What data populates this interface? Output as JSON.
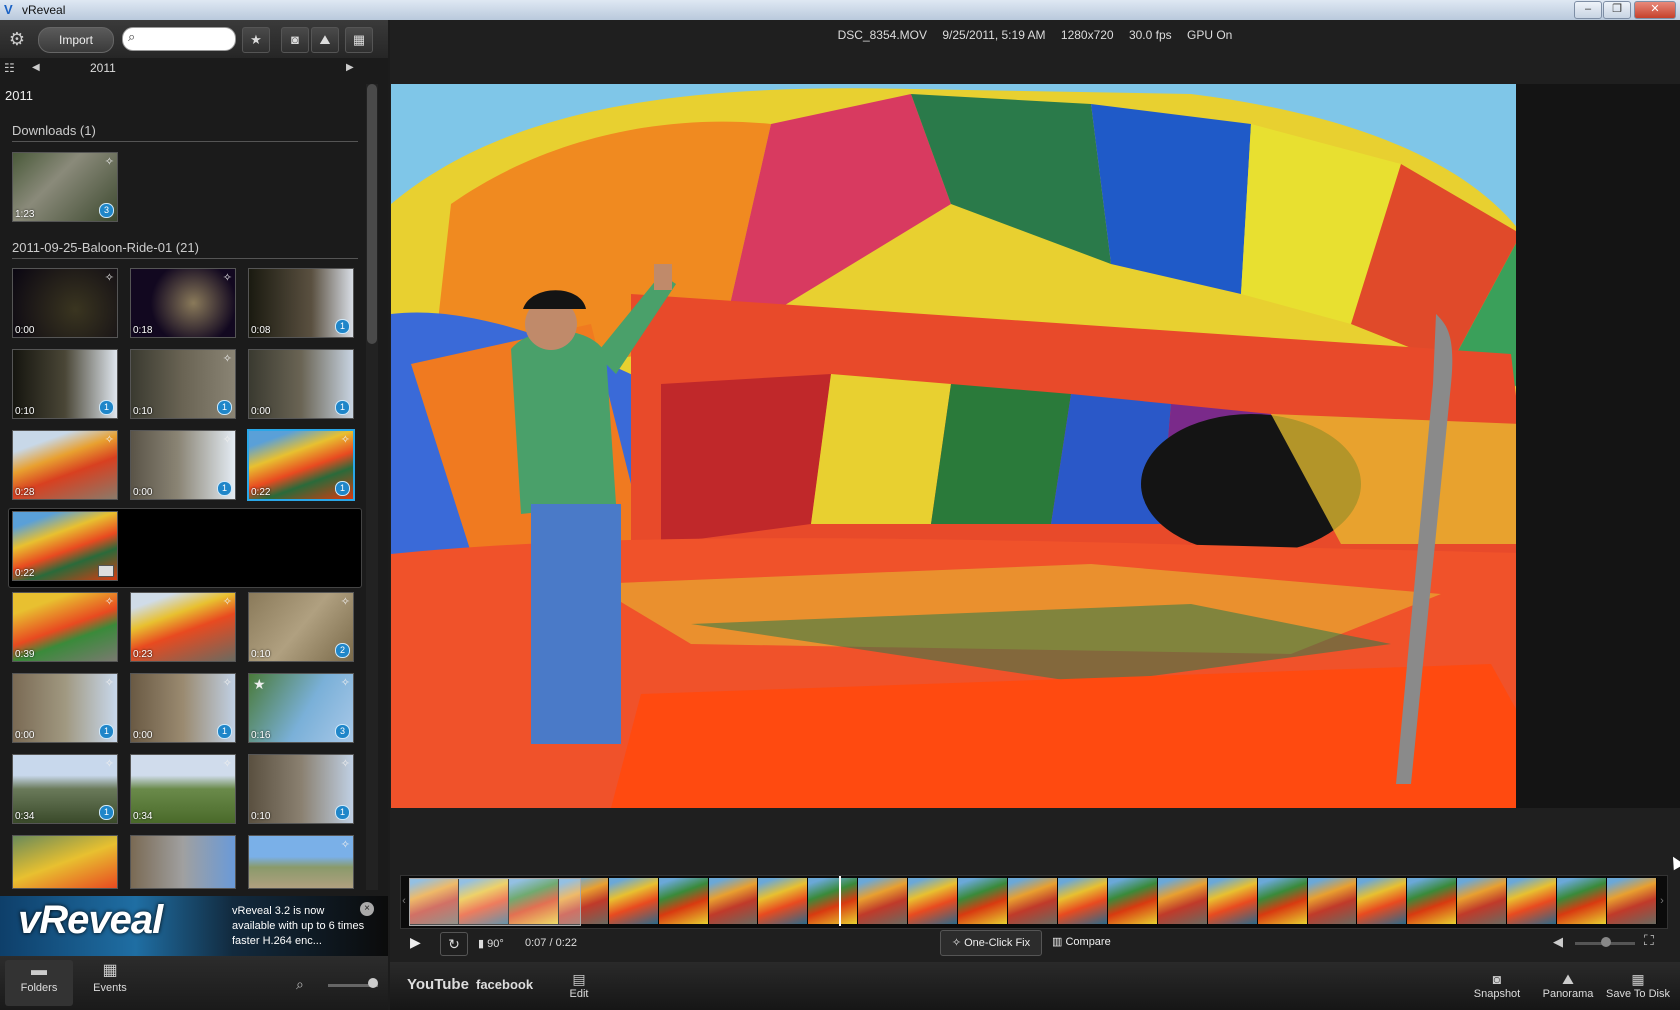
{
  "window": {
    "title": "vReveal",
    "logo": "V"
  },
  "toolbar": {
    "import_label": "Import",
    "search_placeholder": "",
    "gear_icon": "⚙",
    "star_icon": "★",
    "camera_icon": "📷",
    "panorama_icon": "⛰",
    "film_icon": "▦"
  },
  "nav": {
    "year": "2011",
    "prev": "◀",
    "next": "▶",
    "view_icon": "☷"
  },
  "library": {
    "year_heading": "2011",
    "groups": [
      {
        "title": "Downloads (1)"
      },
      {
        "title": "2011-09-25-Baloon-Ride-01 (21)"
      }
    ],
    "downloads": [
      {
        "duration": "1:23",
        "badge": "3"
      }
    ],
    "balloon_rows": [
      [
        {
          "duration": "0:00",
          "badge": ""
        },
        {
          "duration": "0:18",
          "badge": ""
        },
        {
          "duration": "0:08",
          "badge": "1"
        }
      ],
      [
        {
          "duration": "0:10",
          "badge": "1"
        },
        {
          "duration": "0:10",
          "badge": "1"
        },
        {
          "duration": "0:00",
          "badge": "1"
        }
      ],
      [
        {
          "duration": "0:28",
          "badge": ""
        },
        {
          "duration": "0:00",
          "badge": "1"
        },
        {
          "duration": "0:22",
          "badge": "1"
        }
      ],
      [
        {
          "duration": "0:22",
          "badge": ""
        }
      ],
      [
        {
          "duration": "0:39",
          "badge": ""
        },
        {
          "duration": "0:23",
          "badge": ""
        },
        {
          "duration": "0:10",
          "badge": "2"
        }
      ],
      [
        {
          "duration": "0:00",
          "badge": "1"
        },
        {
          "duration": "0:00",
          "badge": "1"
        },
        {
          "duration": "0:16",
          "badge": "3"
        }
      ],
      [
        {
          "duration": "0:34",
          "badge": "1"
        },
        {
          "duration": "0:34",
          "badge": ""
        },
        {
          "duration": "0:10",
          "badge": "1"
        }
      ]
    ]
  },
  "ad": {
    "logo": "vReveal",
    "text": "vReveal 3.2 is now available with up to 6 times  faster H.264 enc...",
    "close": "×"
  },
  "bottom_left": {
    "folders_label": "Folders",
    "events_label": "Events",
    "folders_icon": "▬",
    "events_icon": "▦",
    "zoom_icon": "🔍"
  },
  "info_bar": {
    "filename": "DSC_8354.MOV",
    "datetime": "9/25/2011, 5:19 AM",
    "resolution": "1280x720",
    "fps": "30.0 fps",
    "gpu": "GPU On"
  },
  "controls": {
    "play_icon": "▶",
    "loop_icon": "↻",
    "rotate": "90°",
    "time": "0:07 / 0:22",
    "one_click_fix": "One-Click Fix",
    "compare": "Compare",
    "volume_icon": "◀",
    "fullscreen_icon": "⛶",
    "volume_level": 0.5
  },
  "share": {
    "youtube": "YouTube",
    "facebook": "facebook",
    "edit": "Edit",
    "snapshot": "Snapshot",
    "panorama": "Panorama",
    "save_to_disk": "Save To Disk"
  },
  "colors": {
    "accent": "#2aa7e8",
    "badge": "#1f86c9"
  }
}
